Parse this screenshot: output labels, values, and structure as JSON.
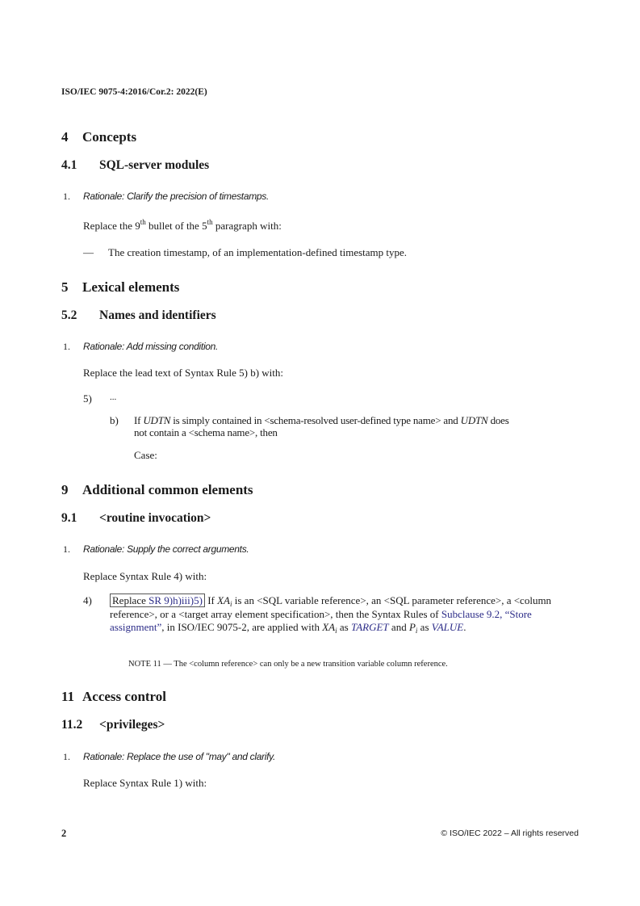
{
  "header": {
    "doc_id": "ISO/IEC 9075-4:2016/Cor.2: 2022(E)"
  },
  "sections": {
    "s4": {
      "num": "4",
      "title": "Concepts"
    },
    "s4_1": {
      "num": "4.1",
      "title": "SQL-server modules"
    },
    "s4_1_item1": {
      "num": "1.",
      "rationale": "Rationale: Clarify the precision of timestamps.",
      "replace_a": "Replace the 9",
      "sup1": "th",
      "replace_b": " bullet of the 5",
      "sup2": "th",
      "replace_c": " paragraph with:",
      "dash": "—",
      "bullet": "The creation timestamp, of an implementation-defined timestamp type."
    },
    "s5": {
      "num": "5",
      "title": "Lexical elements"
    },
    "s5_2": {
      "num": "5.2",
      "title": "Names and identifiers"
    },
    "s5_2_item1": {
      "num": "1.",
      "rationale": "Rationale: Add missing condition.",
      "replace": "Replace the lead text of Syntax Rule 5) b) with:",
      "rule_num": "5)",
      "ellipsis": "...",
      "sub_label": "b)",
      "sub_if": "If ",
      "udtn": "UDTN",
      "sub_text_a": " is simply contained in <schema-resolved user-defined type name> and ",
      "sub_text_b": " does",
      "sub_text_c": "not contain a <schema name>, then",
      "case": "Case:"
    },
    "s9": {
      "num": "9",
      "title": "Additional common elements"
    },
    "s9_1": {
      "num": "9.1",
      "title": "<routine invocation>"
    },
    "s9_1_item1": {
      "num": "1.",
      "rationale": "Rationale: Supply the correct arguments.",
      "replace": "Replace Syntax Rule 4) with:",
      "rule_num": "4)",
      "box_replace": "Replace ",
      "box_link": "SR 9)h)iii)5)",
      "t1": " If ",
      "xa": "XA",
      "sub_i": "i",
      "t2": " is an <SQL variable reference>, an <SQL parameter reference>, a <column reference>, or a <target array element specification>, then the Syntax Rules of ",
      "link2": "Subclause 9.2, “Store assignment”",
      "t3": ", in ISO/IEC 9075-2, are applied with ",
      "t4": " as ",
      "target": "TARGET",
      "t5": " and ",
      "p": "P",
      "t6": " as ",
      "value": "VALUE",
      "t7": ".",
      "note": "NOTE 11 — The <column reference> can only be a new transition variable column reference."
    },
    "s11": {
      "num": "11",
      "title": "Access control"
    },
    "s11_2": {
      "num": "11.2",
      "title": "<privileges>"
    },
    "s11_2_item1": {
      "num": "1.",
      "rationale": "Rationale: Replace the use of \"may\" and clarify.",
      "replace": "Replace Syntax Rule 1) with:"
    }
  },
  "footer": {
    "page_number": "2",
    "copyright": "© ISO/IEC 2022 – All rights reserved"
  },
  "colors": {
    "link": "#2c2c88",
    "text": "#1a1a1a"
  }
}
